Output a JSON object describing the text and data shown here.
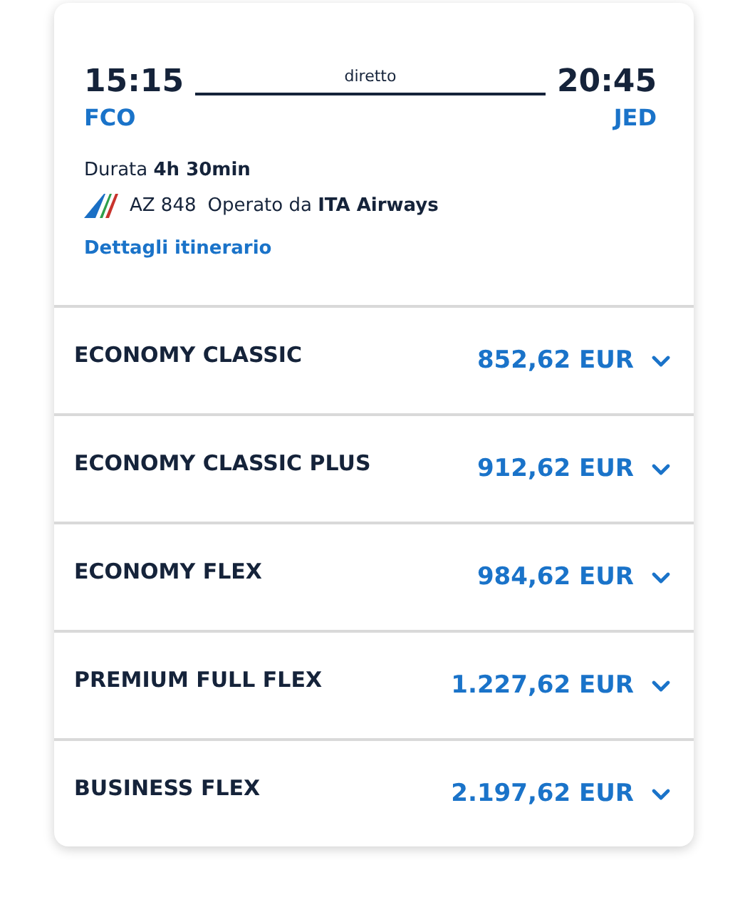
{
  "flight": {
    "departure_time": "15:15",
    "arrival_time": "20:45",
    "stops": "diretto",
    "origin": "FCO",
    "destination": "JED",
    "duration": "Durata **4h 30min**",
    "flight_number": "AZ 848",
    "operator": "Operato da **ITA Airways**",
    "details_link": "Dettagli itinerario"
  },
  "fares": [
    {
      "name": "ECONOMY CLASSIC",
      "price": "852,62 EUR"
    },
    {
      "name": "ECONOMY CLASSIC PLUS",
      "price": "912,62 EUR"
    },
    {
      "name": "ECONOMY FLEX",
      "price": "984,62 EUR"
    },
    {
      "name": "PREMIUM FULL FLEX",
      "price": "1.227,62 EUR"
    },
    {
      "name": "BUSINESS FLEX",
      "price": "2.197,62 EUR"
    }
  ]
}
